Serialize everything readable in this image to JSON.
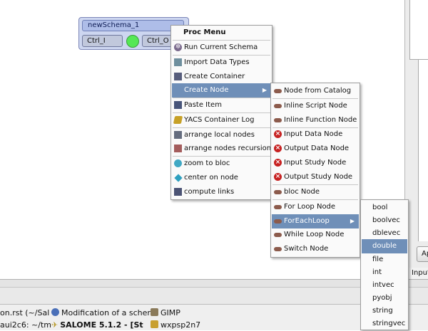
{
  "schema_node": {
    "title": "newSchema_1",
    "ctrl_in": "Ctrl_I",
    "ctrl_out": "Ctrl_O",
    "status_color": "#55e855"
  },
  "proc_menu": {
    "title": "Proc Menu",
    "items": [
      {
        "label": "Run Current Schema",
        "icon": "gear-icon"
      },
      {
        "label": "Import Data Types",
        "icon": "import-icon"
      },
      {
        "label": "Create Container",
        "icon": "container-icon"
      },
      {
        "label": "Create Node",
        "icon": "",
        "submenu": true,
        "selected": true
      },
      {
        "label": "Paste Item",
        "icon": "paste-icon"
      },
      {
        "label": "YACS Container Log",
        "icon": "log-icon"
      },
      {
        "label": "arrange local nodes",
        "icon": "arrange-icon"
      },
      {
        "label": "arrange nodes recursion",
        "icon": "arrange-recursion-icon"
      },
      {
        "label": "zoom to bloc",
        "icon": "zoom-icon"
      },
      {
        "label": "center on node",
        "icon": "center-icon"
      },
      {
        "label": "compute links",
        "icon": "links-icon"
      }
    ]
  },
  "create_node_menu": {
    "items": [
      {
        "label": "Node from Catalog"
      },
      {
        "label": "Inline Script Node"
      },
      {
        "label": "Inline Function Node"
      },
      {
        "label": "Input Data Node"
      },
      {
        "label": "Output Data Node"
      },
      {
        "label": "Input Study Node"
      },
      {
        "label": "Output Study Node"
      },
      {
        "label": "bloc Node"
      },
      {
        "label": "For Loop Node"
      },
      {
        "label": "ForEachLoop",
        "submenu": true,
        "selected": true
      },
      {
        "label": "While Loop Node"
      },
      {
        "label": "Switch Node"
      }
    ]
  },
  "foreach_menu": {
    "items": [
      "bool",
      "boolvec",
      "dblevec",
      "double",
      "file",
      "int",
      "intvec",
      "pyobj",
      "string",
      "stringvec"
    ],
    "selected": "double"
  },
  "right_panel": {
    "apply_label": "Ap",
    "input_tab": "Input"
  },
  "taskbar": {
    "row1": [
      {
        "label": "on.rst (~/Sal",
        "icon": ""
      },
      {
        "label": "Modification of a scher",
        "icon": "browser-icon"
      },
      {
        "label": "GIMP",
        "icon": "gimp-icon"
      }
    ],
    "row2": [
      {
        "label": "aui2c6: ~/tm",
        "icon": ""
      },
      {
        "label": "SALOME 5.1.2 - [St",
        "icon": "salome-icon"
      },
      {
        "label": "wxpsp2n7",
        "icon": "image-icon"
      }
    ]
  },
  "colors": {
    "menu_selected": "#6f8fb8",
    "node_header": "#aebde8",
    "node_body": "#cdd6f0",
    "status_green": "#55e855"
  }
}
